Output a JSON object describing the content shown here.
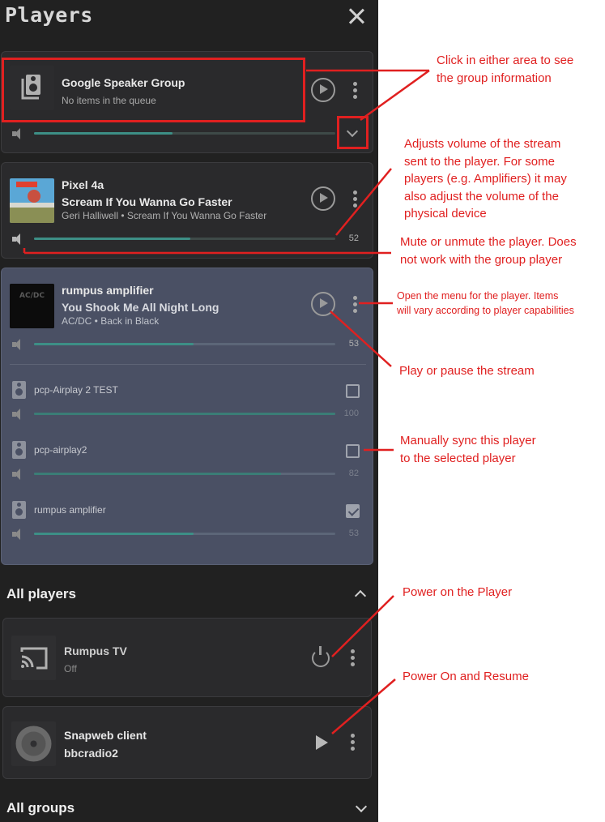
{
  "panel": {
    "title": "Players"
  },
  "group_player": {
    "name": "Google Speaker Group",
    "status": "No items in the queue",
    "volume_fraction": 0.46
  },
  "pixel": {
    "name": "Pixel 4a",
    "track": "Scream If You Wanna Go Faster",
    "artist_album": "Geri Halliwell • Scream If You Wanna Go Faster",
    "volume": "52"
  },
  "rumpus": {
    "name": "rumpus amplifier",
    "track": "You Shook Me All Night Long",
    "artist_album": "AC/DC • Back in Black",
    "volume": "53",
    "sync_players": [
      {
        "name": "pcp-Airplay 2 TEST",
        "volume": "100",
        "checked": false
      },
      {
        "name": "pcp-airplay2",
        "volume": "82",
        "checked": false
      },
      {
        "name": "rumpus amplifier",
        "volume": "53",
        "checked": true
      }
    ]
  },
  "all_players": {
    "title": "All players",
    "items": [
      {
        "name": "Rumpus TV",
        "status": "Off"
      },
      {
        "name": "Snapweb client",
        "status": "bbcradio2"
      }
    ]
  },
  "all_groups": {
    "title": "All groups"
  },
  "annotations": {
    "group_info": [
      "Click in either area to see",
      "the group information"
    ],
    "volume": [
      "Adjusts volume of the stream",
      "sent to the player. For some",
      "players (e.g. Amplifiers) it may",
      "also adjust the volume of the",
      "physical device"
    ],
    "mute": [
      "Mute or unmute the player. Does",
      "not work with the group player"
    ],
    "menu": [
      "Open the menu for the player. Items",
      "will vary according to player capabilities"
    ],
    "play_pause": "Play or pause the stream",
    "sync": [
      "Manually sync this player",
      "to the selected player"
    ],
    "power_on": "Power on the Player",
    "power_resume": "Power On and Resume"
  },
  "colors": {
    "panel_bg": "#212121",
    "selected_card_bg": "#4a5064",
    "slider_fill": "#3d8f86",
    "annotation_red": "#e02020"
  }
}
